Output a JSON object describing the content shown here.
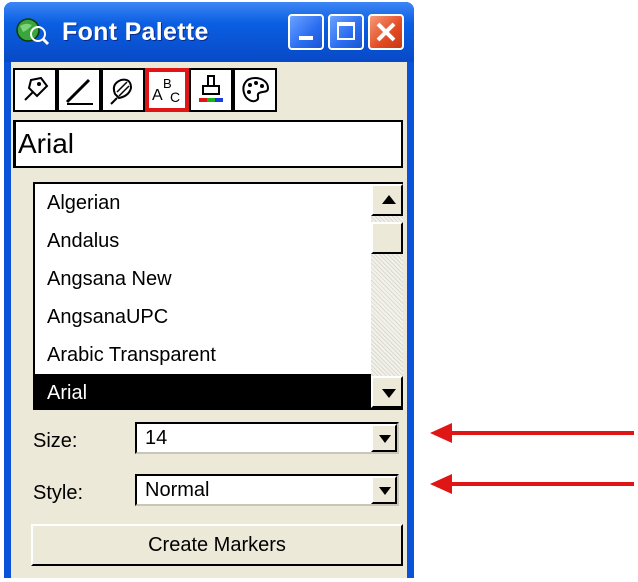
{
  "window": {
    "title": "Font Palette",
    "title_icon": "map-globe-icon",
    "controls": [
      "minimize-icon",
      "maximize-icon",
      "close-icon"
    ]
  },
  "toolbar": {
    "tools": [
      {
        "name": "point-symbol-tool",
        "icon": "pushpin-icon",
        "selected": false
      },
      {
        "name": "line-tool",
        "icon": "pencil-line-icon",
        "selected": false
      },
      {
        "name": "fill-tool",
        "icon": "fill-pattern-icon",
        "selected": false
      },
      {
        "name": "font-tool",
        "icon": "abc-text-icon",
        "selected": true
      },
      {
        "name": "color-tool",
        "icon": "paint-brush-icon",
        "selected": false
      },
      {
        "name": "palette-tool",
        "icon": "color-palette-icon",
        "selected": false
      }
    ]
  },
  "font_name": "Arial",
  "font_list": {
    "items": [
      "Algerian",
      "Andalus",
      "Angsana New",
      "AngsanaUPC",
      "Arabic Transparent",
      "Arial"
    ],
    "selected": "Arial"
  },
  "size": {
    "label": "Size:",
    "value": "14"
  },
  "style": {
    "label": "Style:",
    "value": "Normal"
  },
  "create_button": "Create Markers",
  "colors": {
    "title_bar": "#0b5fe2",
    "dialog_bg": "#ece9d8",
    "highlight_box": "#e01515",
    "arrow": "#e01515"
  }
}
